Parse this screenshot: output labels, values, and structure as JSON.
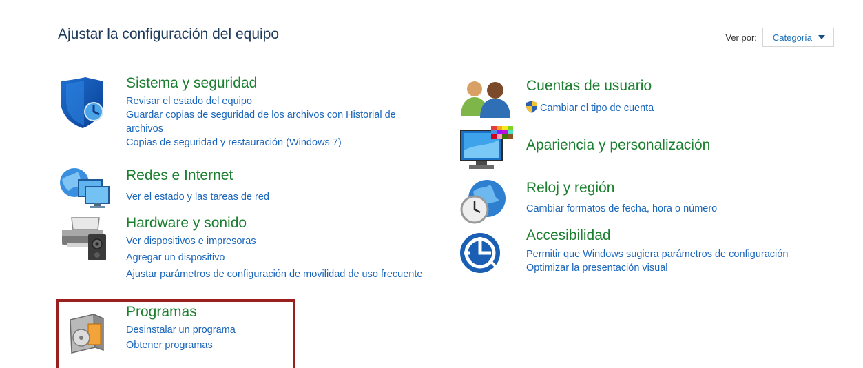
{
  "header": {
    "title": "Ajustar la configuración del equipo",
    "view_by_label": "Ver por:",
    "view_by_value": "Categoría"
  },
  "categories": {
    "system": {
      "title": "Sistema y seguridad",
      "icon": "shield-icon",
      "links": [
        "Revisar el estado del equipo",
        "Guardar copias de seguridad de los archivos con Historial de archivos",
        "Copias de seguridad y restauración (Windows 7)"
      ]
    },
    "network": {
      "title": "Redes e Internet",
      "icon": "network-icon",
      "links": [
        "Ver el estado y las tareas de red"
      ]
    },
    "hardware": {
      "title": "Hardware y sonido",
      "icon": "printer-icon",
      "links": [
        "Ver dispositivos e impresoras",
        "Agregar un dispositivo",
        "Ajustar parámetros de configuración de movilidad de uso frecuente"
      ]
    },
    "programs": {
      "title": "Programas",
      "icon": "programs-icon",
      "links": [
        "Desinstalar un programa",
        "Obtener programas"
      ]
    },
    "users": {
      "title": "Cuentas de usuario",
      "icon": "users-icon",
      "links": [
        "Cambiar el tipo de cuenta"
      ]
    },
    "appearance": {
      "title": "Apariencia y personalización",
      "icon": "monitor-icon",
      "links": []
    },
    "clock": {
      "title": "Reloj y región",
      "icon": "clock-globe-icon",
      "links": [
        "Cambiar formatos de fecha, hora o número"
      ]
    },
    "access": {
      "title": "Accesibilidad",
      "icon": "accessibility-icon",
      "links": [
        "Permitir que Windows sugiera parámetros de configuración",
        "Optimizar la presentación visual"
      ]
    }
  },
  "colors": {
    "category_title": "#1a7f2e",
    "task_link": "#1a66bb",
    "highlight_border": "#9a1f1f"
  }
}
